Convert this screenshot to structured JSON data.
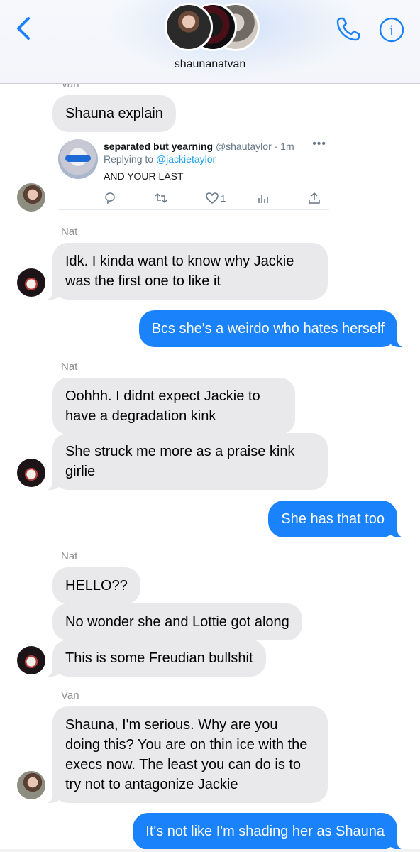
{
  "header": {
    "title": "shaunanatvan",
    "back_icon": "chevron-left-icon",
    "call_icon": "phone-icon",
    "info_icon": "info-icon",
    "info_glyph": "i",
    "accent_color": "#1a82fb"
  },
  "messages": {
    "cut_sender": "Van",
    "m1": "Shauna explain",
    "tweet": {
      "name": "separated but yearning",
      "handle": "@shautaylor · 1m",
      "more": "•••",
      "replying_prefix": "Replying to ",
      "replying_to": "@jackietaylor",
      "text": "AND YOUR LAST",
      "like_count": "1"
    },
    "nat_label_1": "Nat",
    "m2": "Idk. I kinda want to know why Jackie was the first one to like it",
    "m3": "Bcs she's a weirdo who hates herself",
    "nat_label_2": "Nat",
    "m4": "Oohhh. I didnt expect Jackie to have a degradation kink",
    "m5": "She struck me more as a praise kink girlie",
    "m6": "She has that too",
    "nat_label_3": "Nat",
    "m7": "HELLO??",
    "m8": "No wonder she and Lottie got along",
    "m9": "This is some Freudian bullshit",
    "van_label": "Van",
    "m10": "Shauna, I'm serious. Why are you doing this? You are on  thin ice with the execs now. The least you can do is to try not to antagonize Jackie",
    "m11": "It's not like I'm shading her as Shauna"
  }
}
